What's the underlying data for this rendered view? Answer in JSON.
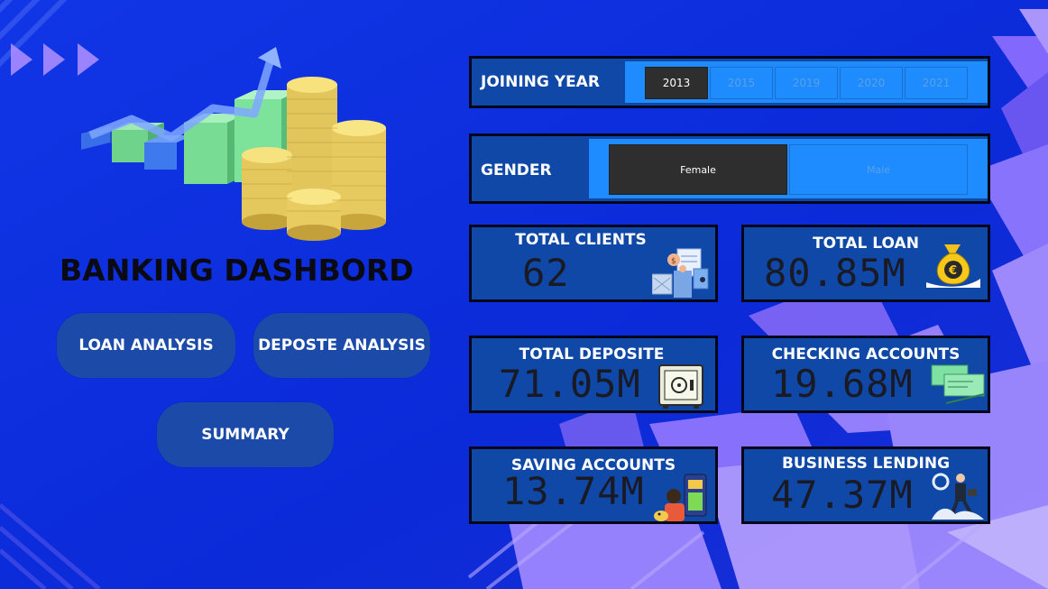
{
  "dashboard": {
    "title": "BANKING DASHBORD"
  },
  "nav": {
    "loan_analysis": "LOAN ANALYSIS",
    "deposit_analysis": "DEPOSTE ANALYSIS",
    "summary": "SUMMARY"
  },
  "filters": {
    "joining_year": {
      "label": "JOINING YEAR",
      "options": [
        "2013",
        "2015",
        "2019",
        "2020",
        "2021"
      ],
      "selected": "2013"
    },
    "gender": {
      "label": "GENDER",
      "options": [
        "Female",
        "Male"
      ],
      "selected": "Female"
    }
  },
  "kpis": {
    "total_clients": {
      "label": "TOTAL CLIENTS",
      "value": "62",
      "icon": "bank-teller-icon"
    },
    "total_loan": {
      "label": "TOTAL LOAN",
      "value": "80.85M",
      "icon": "money-bag-euro-icon"
    },
    "total_deposit": {
      "label": "TOTAL DEPOSITE",
      "value": "71.05M",
      "icon": "safe-icon"
    },
    "checking_accounts": {
      "label": "CHECKING ACCOUNTS",
      "value": "19.68M",
      "icon": "cheque-icon"
    },
    "saving_accounts": {
      "label": "SAVING ACCOUNTS",
      "value": "13.74M",
      "icon": "piggy-savings-icon"
    },
    "business_lending": {
      "label": "BUSINESS LENDING",
      "value": "47.37M",
      "icon": "business-person-icon"
    }
  },
  "colors": {
    "background": "#0d2fe0",
    "card": "#0f48a6",
    "card_border": "#06061a",
    "slicer_track": "#1e8cff",
    "selected_chip": "#2e2e2e",
    "nav_button": "#1b4aa8",
    "accent_purple": "#8f6bff"
  }
}
